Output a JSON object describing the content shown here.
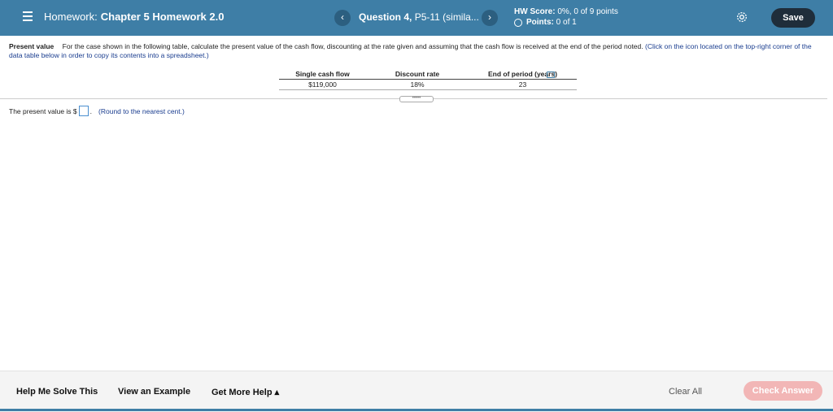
{
  "header": {
    "homework_prefix": "Homework:",
    "homework_name": "Chapter 5 Homework 2.0",
    "prev_label": "‹",
    "next_label": "›",
    "question_label": "Question 4,",
    "question_sub": "P5-11 (simila...",
    "score_label": "HW Score:",
    "score_value": "0%, 0 of 9 points",
    "points_label": "Points:",
    "points_value": "0 of 1",
    "save_label": "Save"
  },
  "problem": {
    "label": "Present value",
    "text": "For the case shown in the following table, calculate the present value of the cash flow, discounting at the rate given and assuming that the cash flow is received at the end of the period noted.",
    "hint": "(Click on the icon located on the top-right corner of the data table below in order to copy its contents into a spreadsheet.)"
  },
  "table": {
    "headers": [
      "Single cash flow",
      "Discount rate",
      "End of period (years)"
    ],
    "rows": [
      [
        "$119,000",
        "18%",
        "23"
      ]
    ]
  },
  "expand_label": "•••••",
  "answer": {
    "prefix": "The present value is $",
    "suffix": ".",
    "note": "(Round to the nearest cent.)",
    "value": ""
  },
  "footer": {
    "help_solve": "Help Me Solve This",
    "view_example": "View an Example",
    "more_help": "Get More Help ▴",
    "clear_all": "Clear All",
    "check_answer": "Check Answer"
  },
  "colors": {
    "header_bg": "#3e7ea6",
    "save_bg": "#1f2d3a",
    "check_answer_bg": "#f2b6b6",
    "hint_text": "#1a3d8f"
  },
  "icons": [
    "menu-icon",
    "chevron-left-icon",
    "chevron-right-icon",
    "points-circle-icon",
    "gear-icon",
    "copy-icon"
  ]
}
